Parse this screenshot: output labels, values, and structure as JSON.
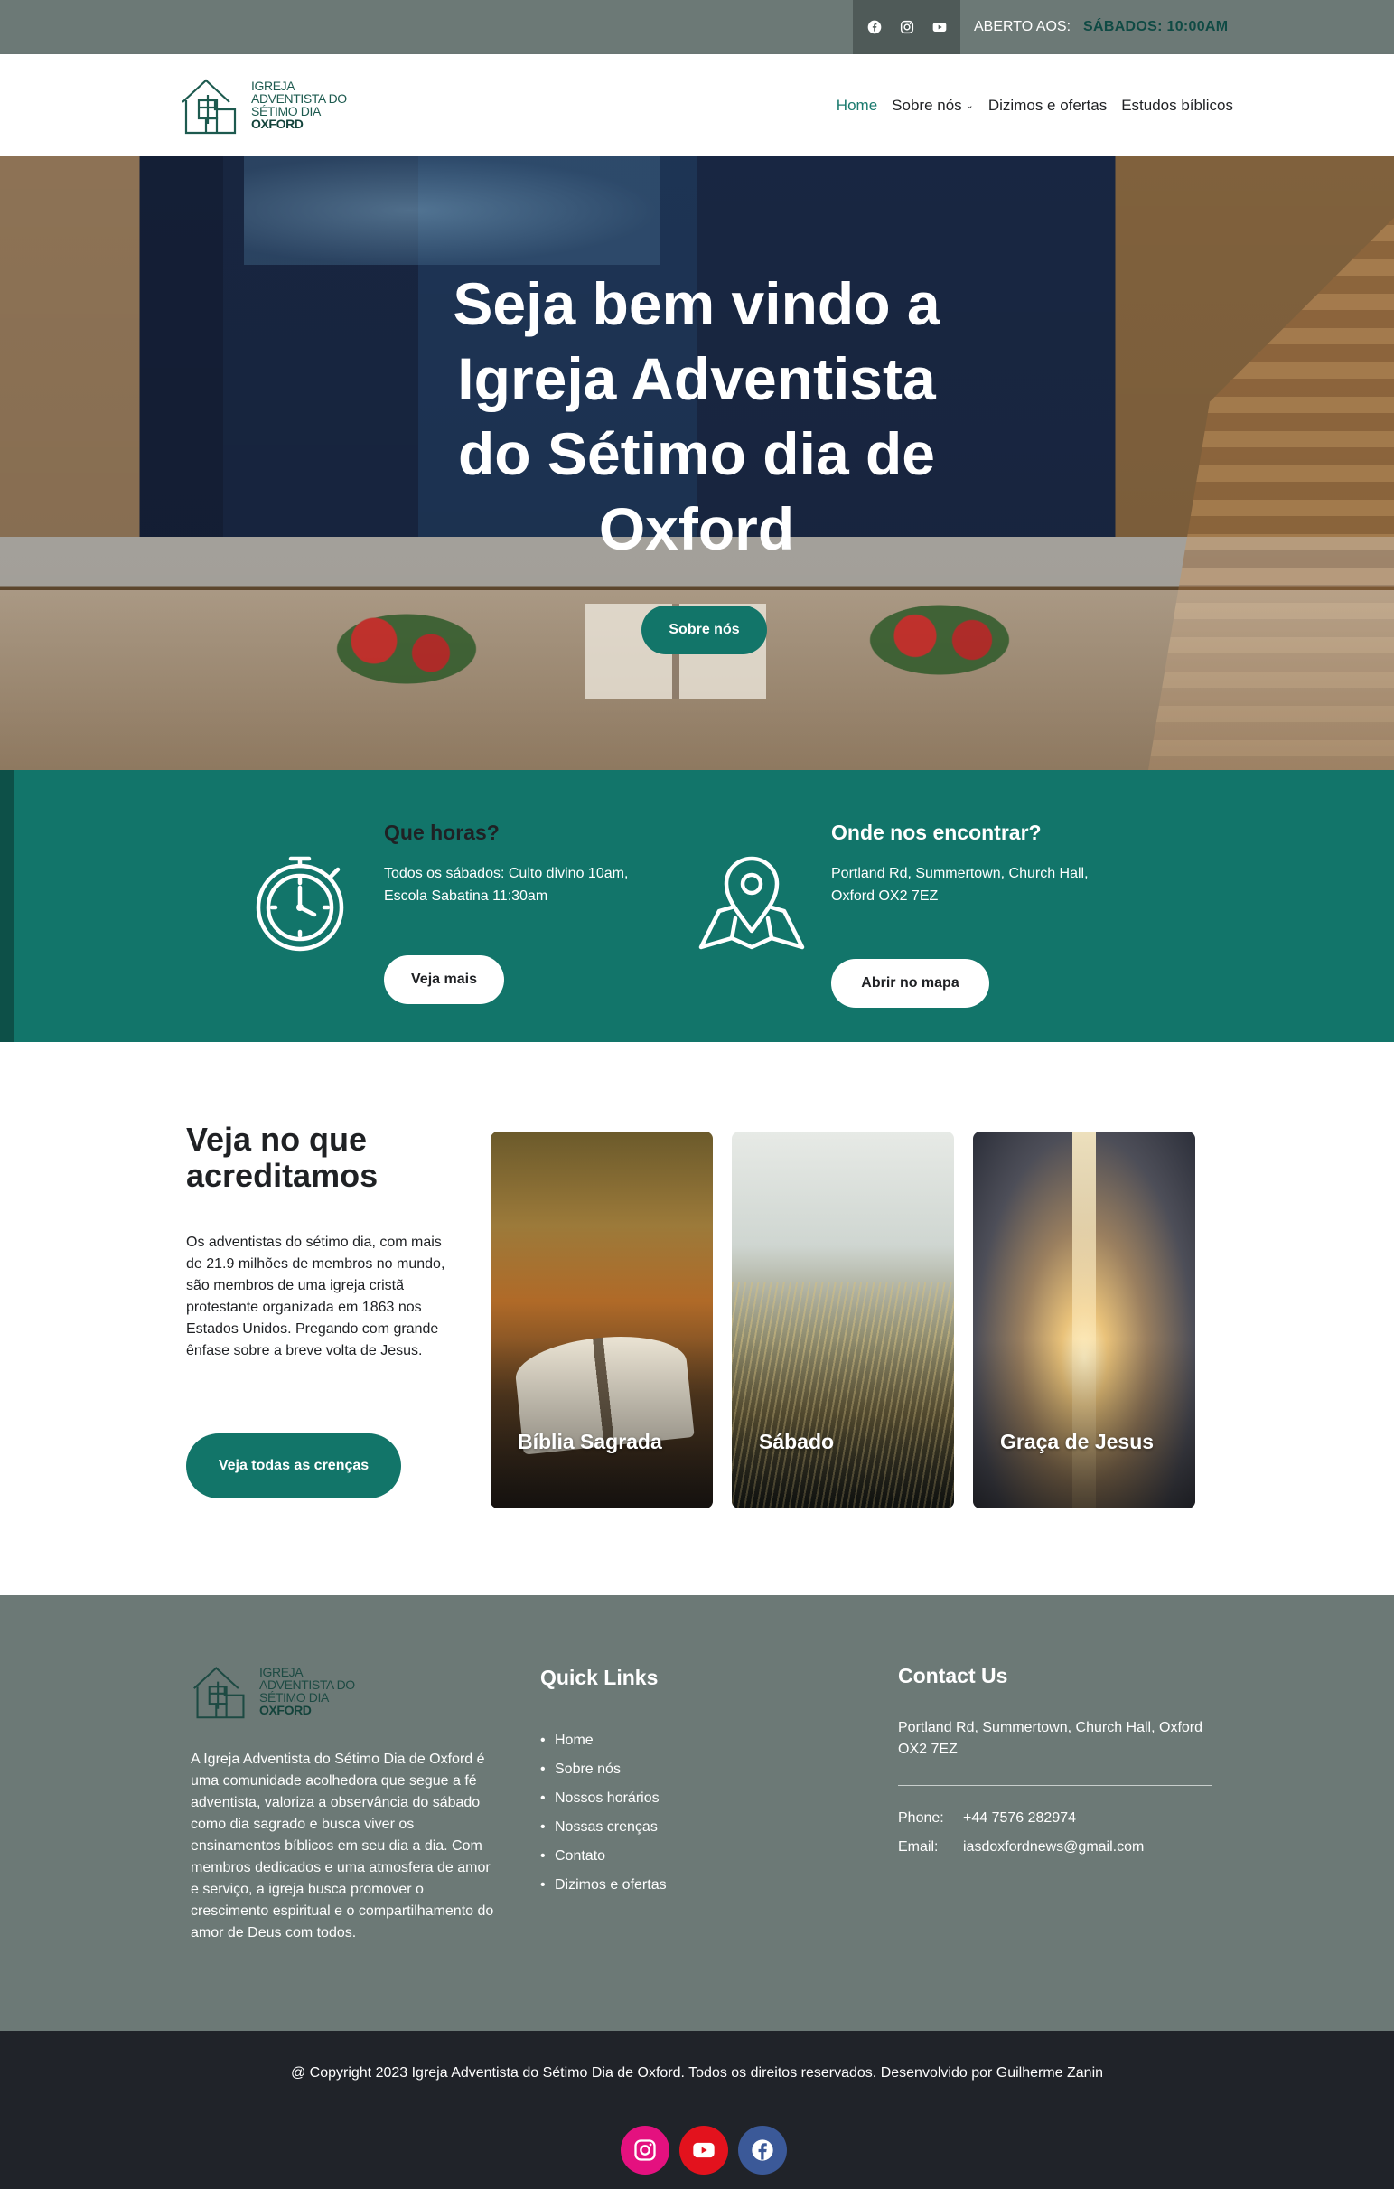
{
  "topbar": {
    "social_icons": [
      "facebook-icon",
      "instagram-icon",
      "youtube-icon"
    ],
    "open_label": "ABERTO AOS:",
    "open_time": "SÁBADOS: 10:00AM"
  },
  "logo": {
    "line1": "IGREJA",
    "line2": "ADVENTISTA DO",
    "line3": "SÉTIMO DIA",
    "line4": "OXFORD"
  },
  "nav": {
    "items": [
      {
        "label": "Home",
        "active": true
      },
      {
        "label": "Sobre nós",
        "has_dropdown": true
      },
      {
        "label": "Dizimos e ofertas"
      },
      {
        "label": "Estudos bíblicos"
      }
    ]
  },
  "hero": {
    "title": "Seja bem vindo a Igreja Adventista do Sétimo dia de Oxford",
    "button": "Sobre nós"
  },
  "info": {
    "hours": {
      "icon": "clock-icon",
      "title": "Que horas?",
      "text": "Todos os sábados: Culto divino 10am, Escola Sabatina 11:30am",
      "button": "Veja mais"
    },
    "location": {
      "icon": "map-pin-icon",
      "title": "Onde nos encontrar?",
      "text": "Portland Rd, Summertown, Church Hall, Oxford OX2 7EZ",
      "button": "Abrir no mapa"
    }
  },
  "beliefs": {
    "title": "Veja no que acreditamos",
    "text": "Os adventistas do sétimo dia, com mais de 21.9 milhões de membros no mundo, são membros de uma igreja cristã protestante organizada em 1863 nos Estados Unidos. Pregando com grande ênfase sobre a breve volta de Jesus.",
    "button": "Veja todas as crenças",
    "cards": [
      {
        "label": "Bíblia Sagrada"
      },
      {
        "label": "Sábado"
      },
      {
        "label": "Graça de Jesus"
      }
    ]
  },
  "footer": {
    "about": "A Igreja Adventista do Sétimo Dia de Oxford é uma comunidade acolhedora que segue a fé adventista, valoriza a observância do sábado como dia sagrado e busca viver os ensinamentos bíblicos em seu dia a dia. Com membros dedicados e uma atmosfera de amor e serviço, a igreja busca promover o crescimento espiritual e o compartilhamento do amor de Deus com todos.",
    "quick_links_title": "Quick Links",
    "quick_links": [
      "Home",
      "Sobre nós",
      "Nossos horários",
      "Nossas crenças",
      "Contato",
      "Dizimos e ofertas"
    ],
    "contact_title": "Contact Us",
    "address": "Portland Rd, Summertown, Church Hall, Oxford OX2 7EZ",
    "phone_label": "Phone:",
    "phone": "+44 7576 282974",
    "email_label": "Email:",
    "email": "iasdoxfordnews@gmail.com"
  },
  "bottombar": {
    "copyright": "@ Copyright 2023 Igreja Adventista do Sétimo Dia de Oxford. Todos os direitos reservados. Desenvolvido por Guilherme Zanin",
    "social": [
      {
        "icon": "instagram-icon",
        "color": "#e4117f"
      },
      {
        "icon": "youtube-icon",
        "color": "#e3121d"
      },
      {
        "icon": "facebook-icon",
        "color": "#3b5998"
      }
    ]
  },
  "colors": {
    "brand_teal": "#12756a",
    "topbar_gray": "#6c7976",
    "footer_dark": "#202329"
  }
}
